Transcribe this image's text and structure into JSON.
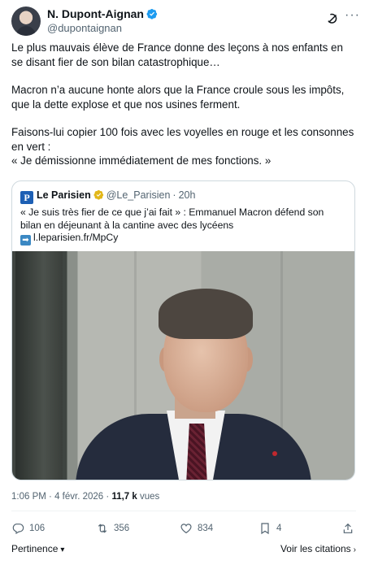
{
  "author": {
    "name": "N. Dupont-Aignan",
    "handle": "@dupontaignan",
    "verified": true
  },
  "tweet": {
    "paragraphs": [
      "Le plus mauvais élève de France donne des leçons à nos enfants en se disant fier de son bilan catastrophique…",
      "Macron n’a aucune honte alors que la France croule sous les impôts, que la dette explose et que nos usines ferment.",
      "Faisons-lui copier 100 fois avec les voyelles en rouge et les consonnes en vert :",
      "« Je démissionne immédiatement de mes fonctions. »"
    ]
  },
  "quote": {
    "logo_letter": "P",
    "name": "Le Parisien",
    "handle": "@Le_Parisien",
    "separator": "·",
    "time": "20h",
    "text": "« Je suis très fier de ce que j’ai fait » : Emmanuel Macron défend son bilan en déjeunant à la cantine avec des lycéens",
    "link_arrow": "➡",
    "link": "l.leparisien.fr/MpCy"
  },
  "meta": {
    "time": "1:06 PM",
    "separator": "·",
    "date": "4 févr. 2026",
    "views_count": "11,7 k",
    "views_label": "vues"
  },
  "actions": {
    "replies": "106",
    "reposts": "356",
    "likes": "834",
    "bookmarks": "4"
  },
  "footer": {
    "sort_label": "Pertinence",
    "quotes_label": "Voir les citations"
  },
  "colors": {
    "text": "#0f1419",
    "secondary": "#536471",
    "verified_blue": "#1d9bf0",
    "gold_badge": "#e2b719",
    "border": "#cfd9de"
  }
}
